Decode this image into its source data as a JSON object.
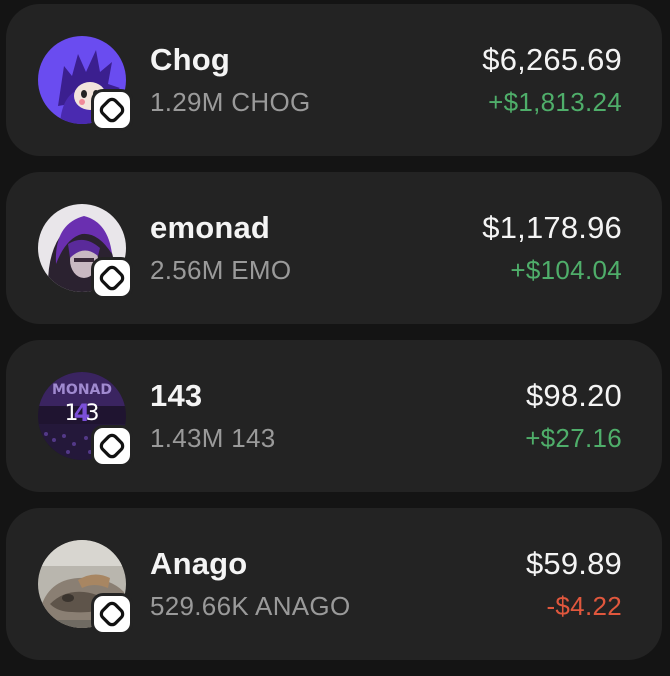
{
  "colors": {
    "background": "#141414",
    "card": "#232323",
    "primary_text": "#f4f4f4",
    "secondary_text": "#9a9a9a",
    "positive": "#4fae6a",
    "negative": "#e0573d",
    "badge": "#ffffff"
  },
  "tokens": [
    {
      "name": "Chog",
      "amount": "1.29M CHOG",
      "value": "$6,265.69",
      "change": "+$1,813.24",
      "direction": "up",
      "avatar_icon": "chog-avatar-icon",
      "badge_icon": "monad-chain-icon"
    },
    {
      "name": "emonad",
      "amount": "2.56M EMO",
      "value": "$1,178.96",
      "change": "+$104.04",
      "direction": "up",
      "avatar_icon": "emonad-avatar-icon",
      "badge_icon": "monad-chain-icon"
    },
    {
      "name": "143",
      "amount": "1.43M 143",
      "value": "$98.20",
      "change": "+$27.16",
      "direction": "up",
      "avatar_icon": "143-avatar-icon",
      "avatar_text": "1 3",
      "avatar_text_mid": "4",
      "avatar_banner": "MONAD",
      "badge_icon": "monad-chain-icon"
    },
    {
      "name": "Anago",
      "amount": "529.66K ANAGO",
      "value": "$59.89",
      "change": "-$4.22",
      "direction": "down",
      "avatar_icon": "anago-avatar-icon",
      "badge_icon": "monad-chain-icon"
    }
  ]
}
